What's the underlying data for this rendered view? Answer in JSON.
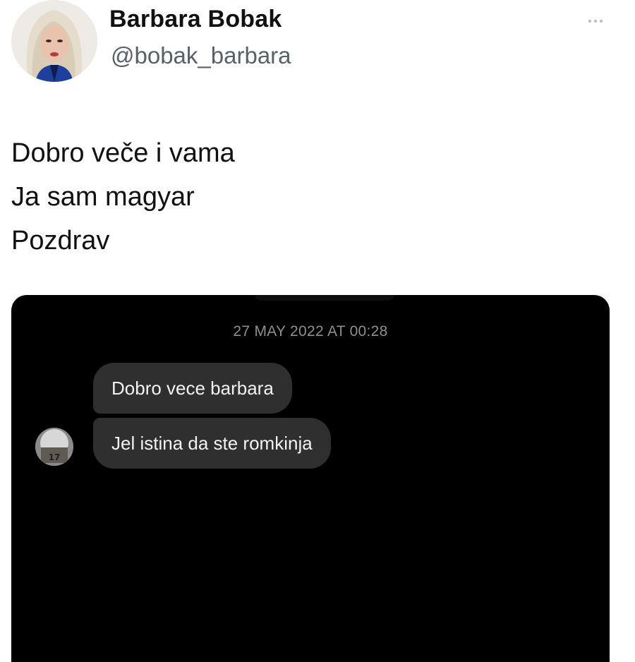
{
  "profile": {
    "display_name": "Barbara Bobak",
    "handle": "@bobak_barbara",
    "avatar_icon": "profile-photo"
  },
  "more_menu": {
    "icon": "more-horizontal-icon"
  },
  "tweet": {
    "lines": [
      "Dobro veče i vama",
      "Ja sam magyar",
      "Pozdrav"
    ]
  },
  "screenshot": {
    "timestamp": "27 MAY 2022 AT 00:28",
    "messages": [
      "Dobro vece barbara",
      "Jel istina da ste romkinja"
    ],
    "sender_avatar_badge": "17",
    "colors": {
      "background": "#000000",
      "bubble": "#2f2f2f",
      "timestamp": "#8e8e93"
    }
  }
}
